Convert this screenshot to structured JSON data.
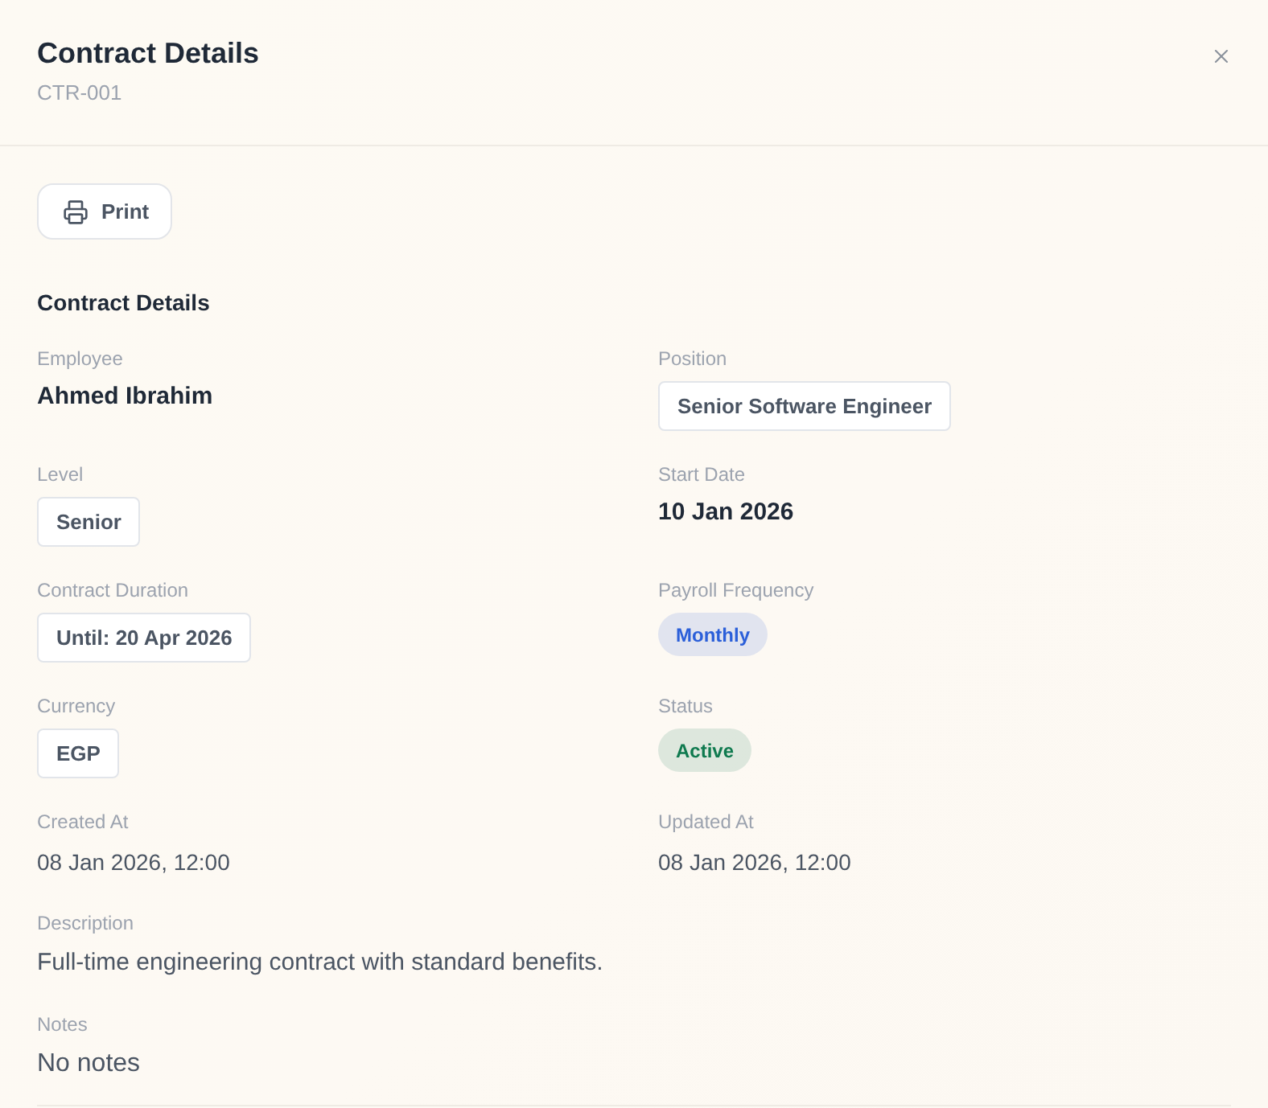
{
  "dialog": {
    "title": "Contract Details",
    "subtitle": "CTR-001"
  },
  "toolbar": {
    "buttons": [
      {
        "label": "Print"
      }
    ]
  },
  "section": {
    "heading": "Contract Details",
    "fields": [
      {
        "label": "Employee",
        "value": "Ahmed Ibrahim",
        "kind": "strong"
      },
      {
        "label": "Position",
        "value": "Senior Software Engineer",
        "kind": "outline"
      },
      {
        "label": "Level",
        "value": "Senior",
        "kind": "outline"
      },
      {
        "label": "Start Date",
        "value": "10 Jan 2026",
        "kind": "strong"
      },
      {
        "label": "Contract Duration",
        "value": "Until: 20 Apr 2026",
        "kind": "outline"
      },
      {
        "label": "Payroll Frequency",
        "value": "Monthly",
        "kind": "pill",
        "color": "#2b5fd9"
      },
      {
        "label": "Currency",
        "value": "EGP",
        "kind": "outline"
      },
      {
        "label": "Status",
        "value": "Active",
        "kind": "pill",
        "color": "#0f7a4f"
      },
      {
        "label": "Created At",
        "value": "08 Jan 2026, 12:00",
        "kind": "plain"
      },
      {
        "label": "Updated At",
        "value": "08 Jan 2026, 12:00",
        "kind": "plain"
      },
      {
        "label": "Description",
        "value": "Full-time engineering contract with standard benefits.",
        "kind": "paragraph"
      },
      {
        "label": "Notes",
        "value": "No notes",
        "kind": "note"
      }
    ]
  }
}
